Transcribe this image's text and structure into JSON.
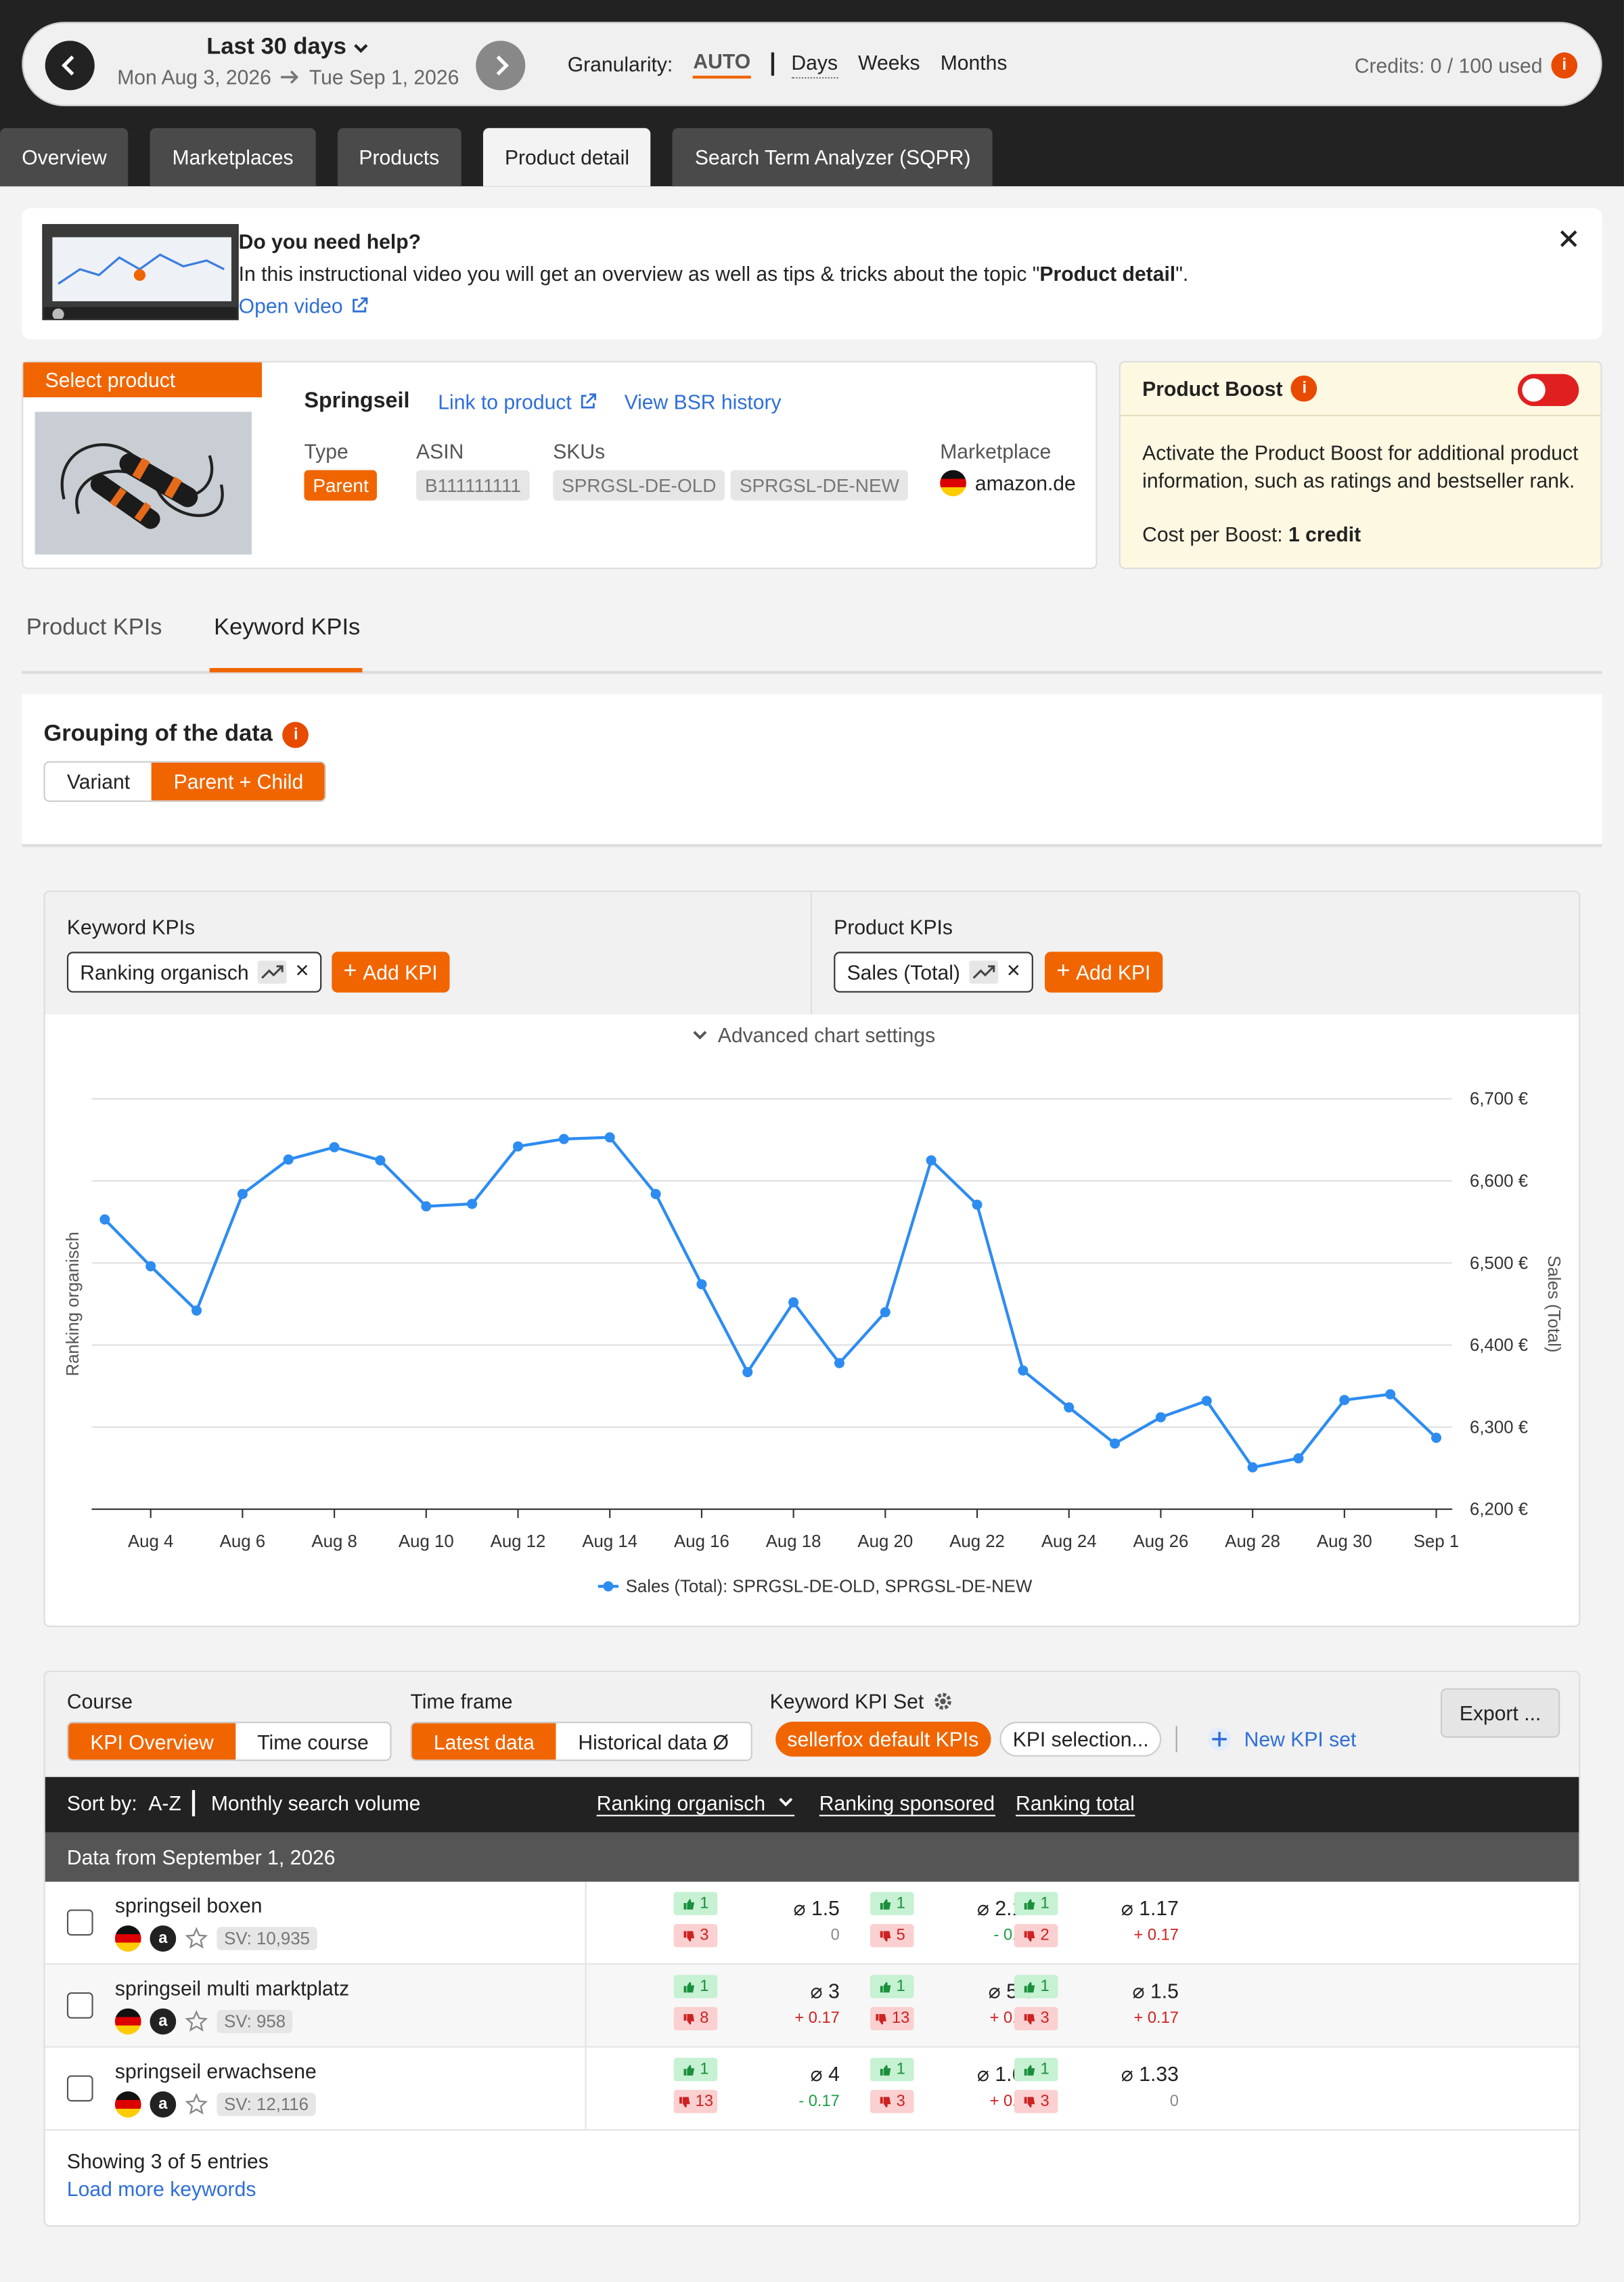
{
  "header": {
    "date_title": "Last 30 days",
    "date_from": "Mon Aug 3, 2026",
    "date_to": "Tue Sep 1, 2026",
    "granularity_label": "Granularity:",
    "granularity_options": [
      "AUTO",
      "Days",
      "Weeks",
      "Months"
    ],
    "credits": "Credits: 0 / 100 used",
    "info_glyph": "i"
  },
  "tabs": [
    "Overview",
    "Marketplaces",
    "Products",
    "Product detail",
    "Search Term Analyzer (SQPR)"
  ],
  "help": {
    "title": "Do you need help?",
    "text_prefix": "In this instructional video you will get an overview as well as tips & tricks about the topic \"",
    "text_bold": "Product detail",
    "text_suffix": "\".",
    "link": "Open video"
  },
  "product": {
    "select_label": "Select product",
    "name": "Springseil",
    "link_product": "Link to product",
    "link_bsr": "View BSR history",
    "type_label": "Type",
    "type_value": "Parent",
    "asin_label": "ASIN",
    "asin_value": "B111111111",
    "skus_label": "SKUs",
    "skus": [
      "SPRGSL-DE-OLD",
      "SPRGSL-DE-NEW"
    ],
    "marketplace_label": "Marketplace",
    "marketplace_value": "amazon.de"
  },
  "boost": {
    "title": "Product Boost",
    "text": "Activate the Product Boost for additional product information, such as ratings and bestseller rank.",
    "cost_label": "Cost per Boost:",
    "cost_value": "1 credit",
    "enabled": false
  },
  "kpi_tabs": [
    "Product KPIs",
    "Keyword KPIs"
  ],
  "grouping": {
    "title": "Grouping of the data",
    "options": [
      "Variant",
      "Parent + Child"
    ],
    "selected": "Parent + Child"
  },
  "chart_panel": {
    "keyword_kpis_label": "Keyword KPIs",
    "keyword_kpi": "Ranking organisch",
    "product_kpis_label": "Product KPIs",
    "product_kpi": "Sales (Total)",
    "add_kpi": "Add KPI",
    "advanced": "Advanced chart settings",
    "remove_glyph": "×",
    "plus_glyph": "+"
  },
  "chart_data": {
    "type": "line",
    "title": "",
    "xlabel": "",
    "ylabel_left": "Ranking organisch",
    "ylabel_right": "Sales (Total)",
    "ylim": [
      6200,
      6700
    ],
    "y_ticks": [
      "6,700 €",
      "6,600 €",
      "6,500 €",
      "6,400 €",
      "6,300 €",
      "6,200 €"
    ],
    "y_tick_values": [
      6700,
      6600,
      6500,
      6400,
      6300,
      6200
    ],
    "x_tick_labels": [
      "Aug 4",
      "Aug 6",
      "Aug 8",
      "Aug 10",
      "Aug 12",
      "Aug 14",
      "Aug 16",
      "Aug 18",
      "Aug 20",
      "Aug 22",
      "Aug 24",
      "Aug 26",
      "Aug 28",
      "Aug 30",
      "Sep 1"
    ],
    "x_tick_index": [
      1,
      3,
      5,
      7,
      9,
      11,
      13,
      15,
      17,
      19,
      21,
      23,
      25,
      27,
      29
    ],
    "grid": true,
    "legend_position": "bottom",
    "series": [
      {
        "name": "Sales (Total): SPRGSL-DE-OLD, SPRGSL-DE-NEW",
        "color": "#2d8cf0",
        "x": [
          "Aug 3",
          "Aug 4",
          "Aug 5",
          "Aug 6",
          "Aug 7",
          "Aug 8",
          "Aug 9",
          "Aug 10",
          "Aug 11",
          "Aug 12",
          "Aug 13",
          "Aug 14",
          "Aug 15",
          "Aug 16",
          "Aug 17",
          "Aug 18",
          "Aug 19",
          "Aug 20",
          "Aug 21",
          "Aug 22",
          "Aug 23",
          "Aug 24",
          "Aug 25",
          "Aug 26",
          "Aug 27",
          "Aug 28",
          "Aug 29",
          "Aug 30",
          "Aug 31",
          "Sep 1"
        ],
        "values": [
          6553,
          6496,
          6442,
          6584,
          6626,
          6641,
          6625,
          6569,
          6572,
          6642,
          6651,
          6653,
          6584,
          6474,
          6367,
          6452,
          6378,
          6440,
          6625,
          6571,
          6369,
          6324,
          6280,
          6312,
          6332,
          6251,
          6262,
          6333,
          6340,
          6287
        ]
      }
    ]
  },
  "table": {
    "course_label": "Course",
    "course_options": [
      "KPI Overview",
      "Time course"
    ],
    "timeframe_label": "Time frame",
    "timeframe_options": [
      "Latest data",
      "Historical data Ø"
    ],
    "kpiset_label": "Keyword KPI Set",
    "kpiset_default": "sellerfox default KPIs",
    "kpiset_selection": "KPI selection...",
    "new_kpi_set": "New KPI set",
    "export": "Export ...",
    "sort_label": "Sort by:",
    "sort_az": "A-Z",
    "sort_sv": "Monthly search volume",
    "col_organic": "Ranking organisch",
    "col_sponsored": "Ranking sponsored",
    "col_total": "Ranking total",
    "data_from": "Data from September 1, 2026",
    "avg_glyph": "⌀",
    "rows": [
      {
        "keyword": "springseil boxen",
        "sv": "SV: 10,935",
        "organic": {
          "up": "1",
          "down": "3",
          "avg": "1.5",
          "delta": "0",
          "delta_type": "neutral"
        },
        "sponsored": {
          "up": "1",
          "down": "5",
          "avg": "2.17",
          "delta": "- 0.33",
          "delta_type": "good"
        },
        "total": {
          "up": "1",
          "down": "2",
          "avg": "1.17",
          "delta": "+ 0.17",
          "delta_type": "bad"
        }
      },
      {
        "keyword": "springseil multi marktplatz",
        "sv": "SV: 958",
        "organic": {
          "up": "1",
          "down": "8",
          "avg": "3",
          "delta": "+ 0.17",
          "delta_type": "bad"
        },
        "sponsored": {
          "up": "1",
          "down": "13",
          "avg": "5.5",
          "delta": "+ 0.33",
          "delta_type": "bad"
        },
        "total": {
          "up": "1",
          "down": "3",
          "avg": "1.5",
          "delta": "+ 0.17",
          "delta_type": "bad"
        }
      },
      {
        "keyword": "springseil erwachsene",
        "sv": "SV: 12,116",
        "organic": {
          "up": "1",
          "down": "13",
          "avg": "4",
          "delta": "- 0.17",
          "delta_type": "good"
        },
        "sponsored": {
          "up": "1",
          "down": "3",
          "avg": "1.67",
          "delta": "+ 0.33",
          "delta_type": "bad"
        },
        "total": {
          "up": "1",
          "down": "3",
          "avg": "1.33",
          "delta": "0",
          "delta_type": "neutral"
        }
      }
    ],
    "showing": "Showing 3 of 5 entries",
    "load_more": "Load more keywords"
  },
  "colors": {
    "accent": "#f06500",
    "link": "#2f6fd6",
    "good": "#1a9e45",
    "bad": "#d02020",
    "line": "#2d8cf0"
  }
}
